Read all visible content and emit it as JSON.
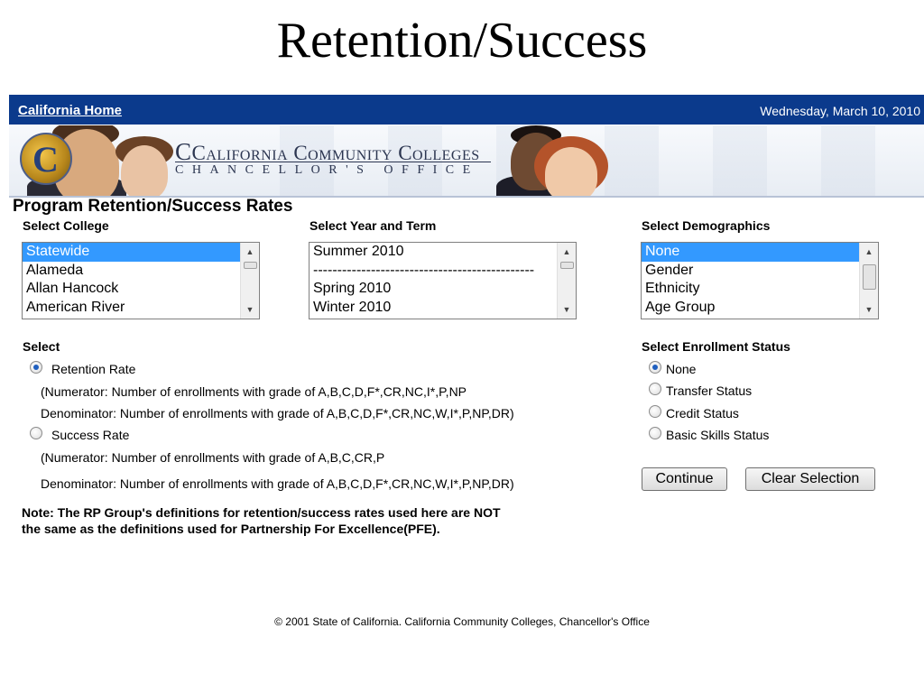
{
  "slide_title": "Retention/Success",
  "topbar": {
    "home_link": "California Home",
    "date": "Wednesday, March 10, 2010"
  },
  "banner": {
    "line1": "California Community Colleges",
    "line2": "CHANCELLOR'S OFFICE"
  },
  "page_heading": "Program Retention/Success Rates",
  "college": {
    "label": "Select College",
    "options": [
      "Statewide",
      "Alameda",
      "Allan Hancock",
      "American River"
    ],
    "selected": "Statewide"
  },
  "term": {
    "label": "Select Year and Term",
    "options": [
      "Summer 2010",
      "----------------------------------------------",
      "Spring 2010",
      "Winter 2010"
    ]
  },
  "demographics": {
    "label": "Select Demographics",
    "options": [
      "None",
      "Gender",
      "Ethnicity",
      "Age Group"
    ],
    "selected": "None"
  },
  "select_rate": {
    "label": "Select",
    "retention": {
      "label": "Retention Rate",
      "numerator": "(Numerator: Number of enrollments with grade of A,B,C,D,F*,CR,NC,I*,P,NP",
      "denominator": "Denominator: Number of enrollments with grade of A,B,C,D,F*,CR,NC,W,I*,P,NP,DR)"
    },
    "success": {
      "label": "Success Rate",
      "numerator": "(Numerator: Number of enrollments with grade of A,B,C,CR,P",
      "denominator": "Denominator: Number of enrollments with grade of A,B,C,D,F*,CR,NC,W,I*,P,NP,DR)"
    },
    "checked": "Retention Rate"
  },
  "enrollment": {
    "label": "Select Enrollment Status",
    "options": [
      "None",
      "Transfer Status",
      "Credit Status",
      "Basic Skills Status"
    ],
    "checked": "None"
  },
  "buttons": {
    "continue": "Continue",
    "clear": "Clear Selection"
  },
  "note": {
    "line1": "Note: The RP Group's definitions for retention/success rates used here are NOT",
    "line2": "the same as the definitions used for Partnership For Excellence(PFE)."
  },
  "footer": "© 2001 State of California. California Community Colleges, Chancellor's Office",
  "colors": {
    "topbar": "#0b3a8c",
    "selection": "#3399ff",
    "radio_dot": "#1f5fbf"
  },
  "icons": {
    "logo": "cccco-logo-icon",
    "scroll_up": "scroll-up-arrow-icon",
    "scroll_down": "scroll-down-arrow-icon"
  }
}
